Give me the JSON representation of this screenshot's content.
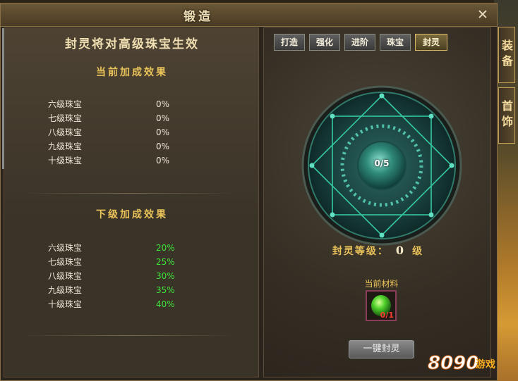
{
  "window": {
    "title": "锻造",
    "close_label": "✕"
  },
  "left": {
    "title": "封灵将对高级珠宝生效",
    "current": {
      "heading": "当前加成效果",
      "rows": [
        {
          "name": "六级珠宝",
          "value": "0%"
        },
        {
          "name": "七级珠宝",
          "value": "0%"
        },
        {
          "name": "八级珠宝",
          "value": "0%"
        },
        {
          "name": "九级珠宝",
          "value": "0%"
        },
        {
          "name": "十级珠宝",
          "value": "0%"
        }
      ]
    },
    "next": {
      "heading": "下级加成效果",
      "rows": [
        {
          "name": "六级珠宝",
          "value": "20%"
        },
        {
          "name": "七级珠宝",
          "value": "25%"
        },
        {
          "name": "八级珠宝",
          "value": "30%"
        },
        {
          "name": "九级珠宝",
          "value": "35%"
        },
        {
          "name": "十级珠宝",
          "value": "40%"
        }
      ]
    }
  },
  "right": {
    "tabs": [
      {
        "label": "打造"
      },
      {
        "label": "强化"
      },
      {
        "label": "进阶"
      },
      {
        "label": "珠宝"
      },
      {
        "label": "封灵"
      }
    ],
    "active_tab": "封灵",
    "seal_progress": "0/5",
    "seal_level_prefix": "封灵等级：",
    "seal_level_value": "0",
    "seal_level_suffix": "级",
    "material_label": "当前材料",
    "material_count": "0/1",
    "seal_button": "一键封灵"
  },
  "side_tabs": [
    {
      "label": "装备"
    },
    {
      "label": "首饰"
    }
  ],
  "watermark": "8090游戏",
  "colors": {
    "gold": "#e9c25a",
    "green": "#3fe23b",
    "red": "#ff3b30",
    "rune": "#5fe0c2"
  }
}
